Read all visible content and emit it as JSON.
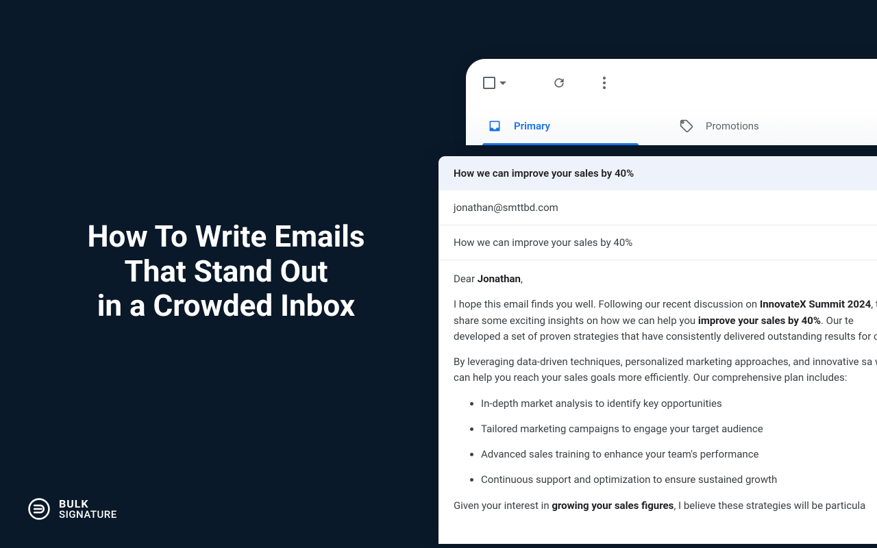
{
  "headline": {
    "line1": "How To Write Emails",
    "line2": "That Stand Out",
    "line3": "in a Crowded Inbox"
  },
  "logo": {
    "top": "BULK",
    "bottom": "SIGNATURE"
  },
  "inbox": {
    "tabs": {
      "primary": "Primary",
      "promotions": "Promotions"
    }
  },
  "compose": {
    "header": "How we can improve your sales by 40%",
    "recipient": "jonathan@smttbd.com",
    "subject": "How we can improve your sales by 40%",
    "greeting_prefix": "Dear ",
    "greeting_name": "Jonathan",
    "p1_a": "I hope this email finds you well. Following our recent discussion on ",
    "p1_bold1": "InnovateX Summit 2024",
    "p1_b": ", to share some exciting insights on how we can help you ",
    "p1_bold2": "improve your sales by 40%",
    "p1_c": ". Our te developed a set of proven strategies that have consistently delivered outstanding results for c",
    "p2": "By leveraging data-driven techniques, personalized marketing approaches, and innovative sa we can help you reach your sales goals more efficiently. Our comprehensive plan includes:",
    "bullets": [
      "In-depth market analysis to identify key opportunities",
      "Tailored marketing campaigns to engage your target audience",
      "Advanced sales training to enhance your team's performance",
      "Continuous support and optimization to ensure sustained growth"
    ],
    "p3_a": "Given your interest in ",
    "p3_bold": "growing your sales figures",
    "p3_b": ", I believe these strategies will be particula"
  }
}
